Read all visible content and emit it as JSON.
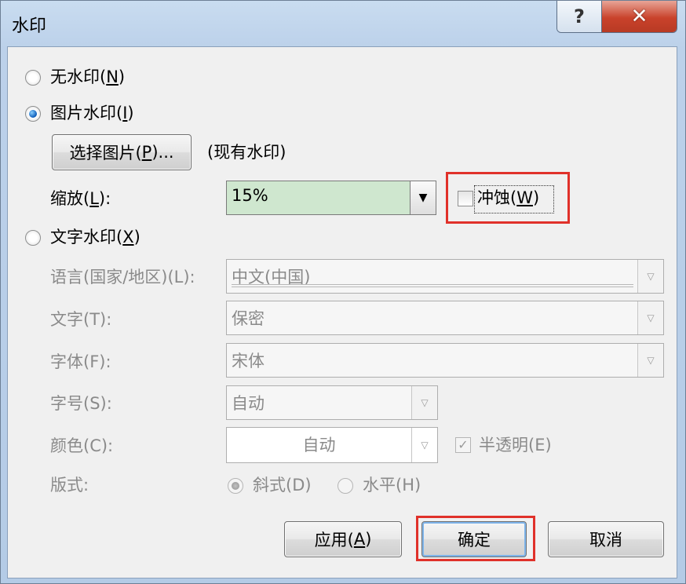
{
  "window": {
    "title": "水印",
    "help_glyph": "?",
    "close_glyph": "✕"
  },
  "no_watermark": {
    "label": "无水印(",
    "key": "N",
    "tail": ")"
  },
  "picture_watermark": {
    "label": "图片水印(",
    "key": "I",
    "tail": ")",
    "select_button": {
      "label": "选择图片(",
      "key": "P",
      "tail": ")..."
    },
    "current": "(现有水印)",
    "scale": {
      "label": "缩放(",
      "key": "L",
      "tail": "):",
      "value": "15%"
    },
    "washout": {
      "label": "冲蚀(",
      "key": "W",
      "tail": ")",
      "checked": false
    }
  },
  "text_watermark": {
    "label": "文字水印(",
    "key": "X",
    "tail": ")",
    "language": {
      "label": "语言(国家/地区)(L):",
      "value": "中文(中国)"
    },
    "text": {
      "label": "文字(T):",
      "value": "保密"
    },
    "font": {
      "label": "字体(F):",
      "value": "宋体"
    },
    "size": {
      "label": "字号(S):",
      "value": "自动"
    },
    "color": {
      "label": "颜色(C):",
      "value": "自动"
    },
    "semitransparent": {
      "label": "半透明(E)",
      "checked": true
    },
    "layout": {
      "label": "版式:",
      "diagonal": "斜式(D)",
      "horizontal": "水平(H)",
      "selected": "diagonal"
    }
  },
  "buttons": {
    "apply": {
      "label": "应用(",
      "key": "A",
      "tail": ")"
    },
    "ok": "确定",
    "cancel": "取消"
  },
  "colors": {
    "highlight": "#e0312a",
    "scale_field_bg": "#cfe7cf",
    "close_button": "#c9422b"
  }
}
